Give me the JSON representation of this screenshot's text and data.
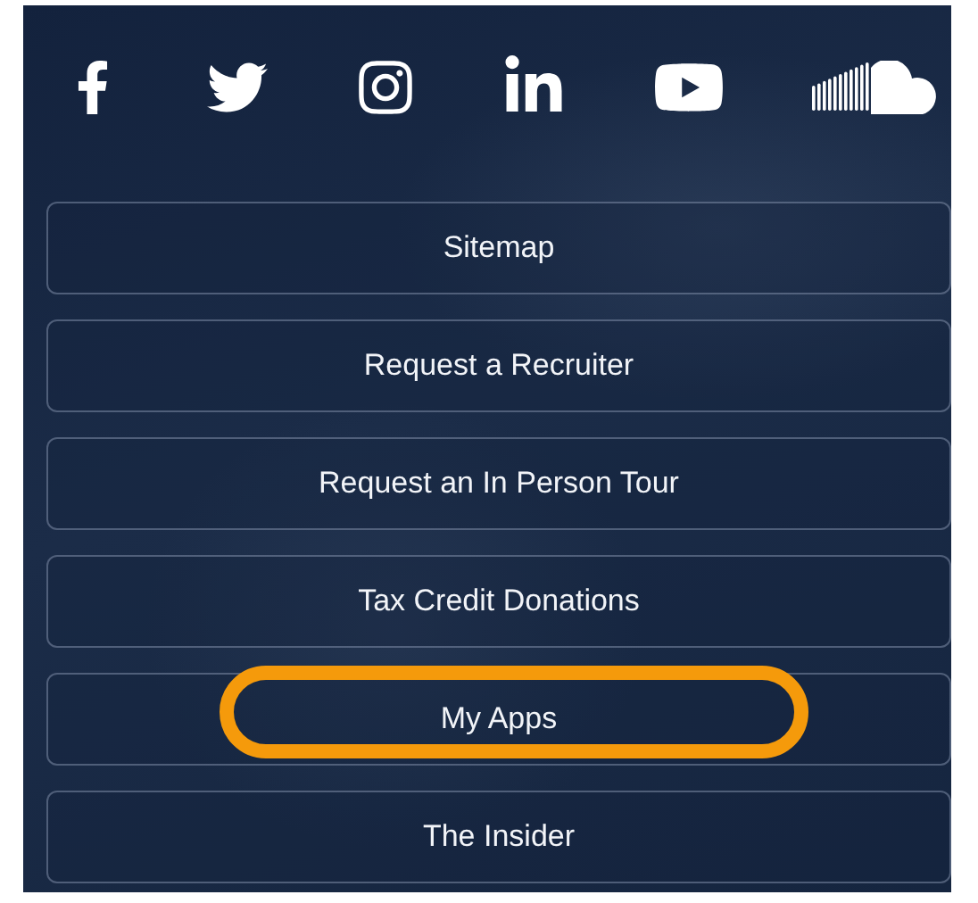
{
  "menu_items": [
    {
      "label": "Sitemap",
      "highlighted": false
    },
    {
      "label": "Request a Recruiter",
      "highlighted": false
    },
    {
      "label": "Request an In Person Tour",
      "highlighted": false
    },
    {
      "label": "Tax Credit Donations",
      "highlighted": false
    },
    {
      "label": "My Apps",
      "highlighted": true
    },
    {
      "label": "The Insider",
      "highlighted": false
    }
  ]
}
